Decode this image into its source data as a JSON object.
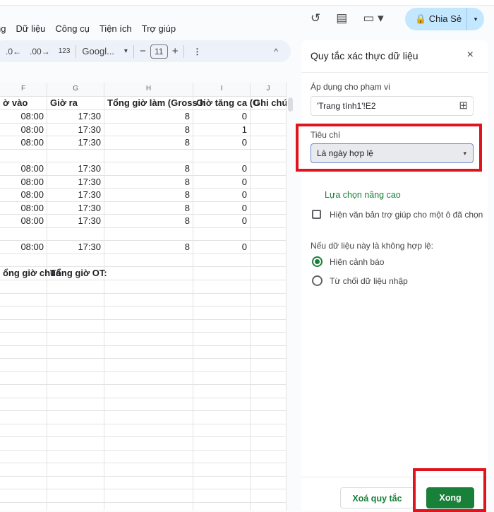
{
  "menu": [
    "ng",
    "Dữ liệu",
    "Công cụ",
    "Tiện ích",
    "Trợ giúp"
  ],
  "toolbar": {
    "dec_less": ".0←",
    "dec_more": ".00→",
    "format": "123",
    "font": "Googl...",
    "font_dd": "▾",
    "minus": "−",
    "font_size": "11",
    "plus": "+",
    "more": "⋮",
    "collapse": "^"
  },
  "header_icons": {
    "history": "↺",
    "comment": "▤",
    "meet": "▭ ▾"
  },
  "share": {
    "label": "🔒 Chia Sẻ",
    "dd": "▾"
  },
  "columns": [
    "F",
    "G",
    "H",
    "I",
    "J"
  ],
  "header_row": [
    "ờ vào",
    "Giờ ra",
    "Tổng giờ làm (Gross h",
    "Giờ tăng ca (C",
    "Ghi chú/"
  ],
  "rows": [
    [
      "08:00",
      "17:30",
      "8",
      "0",
      ""
    ],
    [
      "08:00",
      "17:30",
      "8",
      "1",
      ""
    ],
    [
      "08:00",
      "17:30",
      "8",
      "0",
      ""
    ],
    [
      "",
      "",
      "",
      "",
      ""
    ],
    [
      "08:00",
      "17:30",
      "8",
      "0",
      ""
    ],
    [
      "08:00",
      "17:30",
      "8",
      "0",
      ""
    ],
    [
      "08:00",
      "17:30",
      "8",
      "0",
      ""
    ],
    [
      "08:00",
      "17:30",
      "8",
      "0",
      ""
    ],
    [
      "08:00",
      "17:30",
      "8",
      "0",
      ""
    ],
    [
      "",
      "",
      "",
      "",
      ""
    ],
    [
      "08:00",
      "17:30",
      "8",
      "0",
      ""
    ],
    [
      "",
      "",
      "",
      "",
      ""
    ]
  ],
  "summary_row": [
    "ổng giờ chuẩ",
    "Tổng giờ OT:",
    "",
    "",
    ""
  ],
  "panel": {
    "title": "Quy tắc xác thực dữ liệu",
    "close": "×",
    "range_label": "Áp dụng cho phạm vi",
    "range_value": "'Trang tính1'!E2",
    "grid_icon": "⊞",
    "criteria_label": "Tiêu chí",
    "criteria_value": "Là ngày hợp lệ",
    "criteria_dd": "▾",
    "advanced": "Lựa chọn nâng cao",
    "help_text": "Hiện văn bản trợ giúp cho một ô đã chọn",
    "invalid_label": "Nếu dữ liệu này là không hợp lệ:",
    "opt_warn": "Hiện cảnh báo",
    "opt_reject": "Từ chối dữ liệu nhập",
    "remove": "Xoá quy tắc",
    "done": "Xong"
  },
  "colors": {
    "accent": "#188038",
    "highlight": "#e0141e",
    "share_bg": "#c2e7ff"
  }
}
